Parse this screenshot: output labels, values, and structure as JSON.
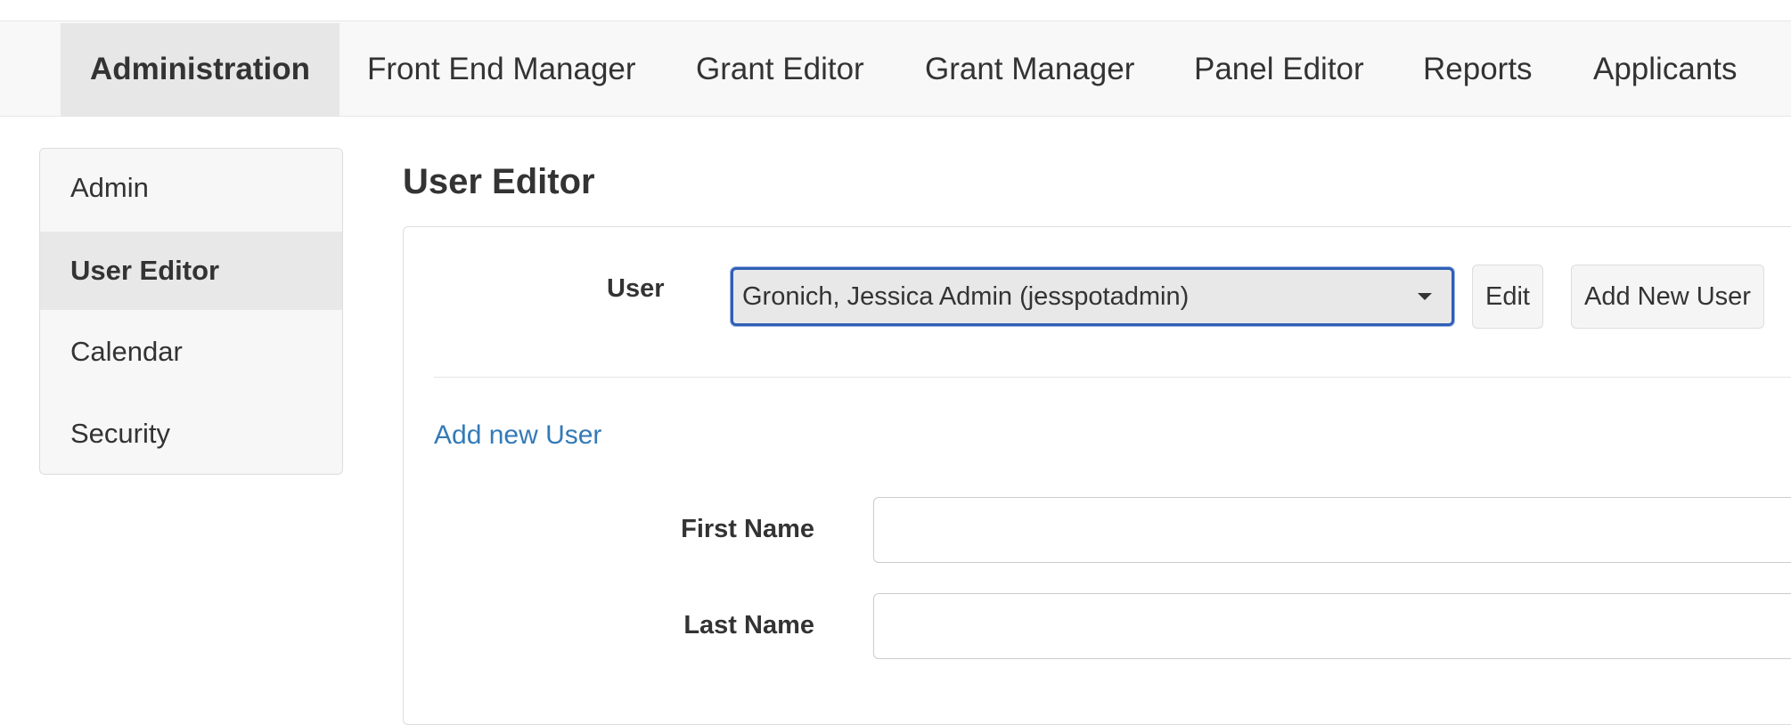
{
  "topnav": {
    "items": [
      {
        "label": "Administration",
        "active": true
      },
      {
        "label": "Front End Manager"
      },
      {
        "label": "Grant Editor"
      },
      {
        "label": "Grant Manager"
      },
      {
        "label": "Panel Editor"
      },
      {
        "label": "Reports"
      },
      {
        "label": "Applicants"
      }
    ]
  },
  "sidebar": {
    "items": [
      {
        "label": "Admin"
      },
      {
        "label": "User Editor",
        "active": true
      },
      {
        "label": "Calendar"
      },
      {
        "label": "Security"
      }
    ]
  },
  "main": {
    "title": "User Editor",
    "user_label": "User",
    "user_select_value": "Gronich, Jessica Admin (jesspotadmin)",
    "edit_button": "Edit",
    "add_new_user_button": "Add New User",
    "add_new_user_link": "Add new User",
    "first_name_label": "First Name",
    "first_name_value": "",
    "last_name_label": "Last Name",
    "last_name_value": ""
  },
  "colors": {
    "link": "#337ab7",
    "focus_border": "#2f5fb5",
    "nav_background": "#f8f8f8",
    "active_background": "#e7e7e7"
  }
}
